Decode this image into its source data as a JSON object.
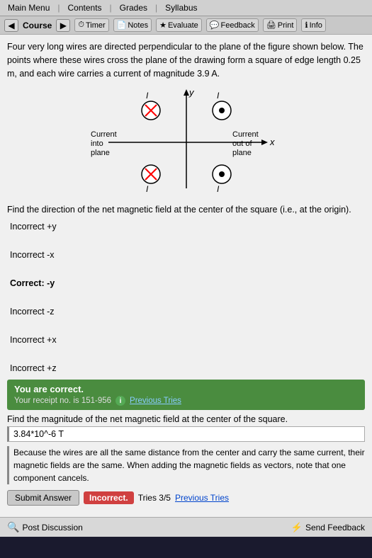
{
  "menu": {
    "items": [
      "Main Menu",
      "Contents",
      "Grades",
      "Syllabus"
    ]
  },
  "toolbar": {
    "back_label": "",
    "course_label": "Course",
    "timer_label": "Timer",
    "notes_label": "Notes",
    "evaluate_label": "Evaluate",
    "feedback_label": "Feedback",
    "print_label": "Print",
    "info_label": "Info"
  },
  "problem": {
    "description": "Four very long wires are directed perpendicular to the plane of the figure shown below. The points where these wires cross the plane of the drawing form a square of edge length 0.25 m, and each wire carries a current of magnitude 3.9 A.",
    "find_direction": "Find the direction of the net magnetic field at the center of the square (i.e., at the origin).",
    "options": [
      {
        "text": "Incorrect +y",
        "correct": false
      },
      {
        "text": "Incorrect -x",
        "correct": false
      },
      {
        "text": "Correct: -y",
        "correct": true
      },
      {
        "text": "Incorrect -z",
        "correct": false
      },
      {
        "text": "Incorrect +x",
        "correct": false
      },
      {
        "text": "Incorrect +z",
        "correct": false
      }
    ],
    "feedback_correct": "You are correct.",
    "receipt_text": "Your receipt no. is 151-956",
    "previous_tries": "Previous Tries",
    "find_magnitude": "Find the magnitude of the net magnetic field at the center of the square.",
    "magnitude_value": "3.84*10^-6 T",
    "explanation": "Because the wires are all the same distance from the center and carry the same current, their magnetic fields are the same. When adding the magnetic fields as vectors, note that one component cancels.",
    "submit_label": "Submit Answer",
    "incorrect_label": "Incorrect.",
    "tries_text": "Tries 3/5",
    "previous_tries2": "Previous Tries",
    "post_discussion": "Post Discussion",
    "send_feedback": "Send Feedback"
  }
}
